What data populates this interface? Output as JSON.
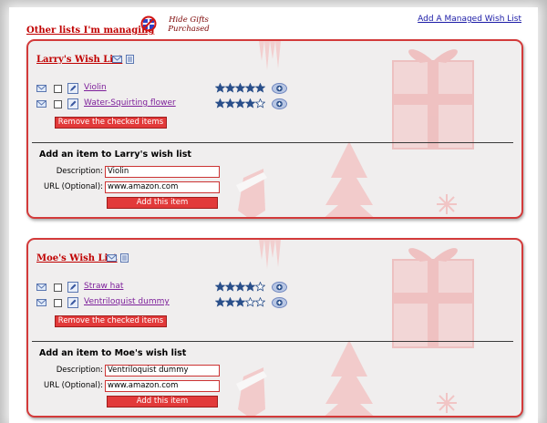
{
  "header": {
    "other_lists_label": "Other lists I'm managing",
    "hide_gifts_line1": "Hide Gifts",
    "hide_gifts_line2": "Purchased",
    "add_managed_link": "Add A Managed Wish List"
  },
  "lists": [
    {
      "title": "Larry's Wish List",
      "items": [
        {
          "name": "Violin",
          "rating": 5,
          "max_rating": 5
        },
        {
          "name": "Water-Squirting flower",
          "rating": 4,
          "max_rating": 5
        }
      ],
      "remove_button": "Remove the checked items",
      "add_heading": "Add an item to Larry's wish list",
      "description_label": "Description:",
      "description_value": "Violin",
      "url_label": "URL (Optional):",
      "url_value": "www.amazon.com",
      "add_button": "Add this item"
    },
    {
      "title": "Moe's Wish List",
      "items": [
        {
          "name": "Straw hat",
          "rating": 4,
          "max_rating": 5
        },
        {
          "name": "Ventriloquist dummy",
          "rating": 3,
          "max_rating": 5
        }
      ],
      "remove_button": "Remove the checked items",
      "add_heading": "Add an item to Moe's wish list",
      "description_label": "Description:",
      "description_value": "Ventriloquist dummy",
      "url_label": "URL (Optional):",
      "url_value": "www.amazon.com",
      "add_button": "Add this item"
    }
  ],
  "icons": {
    "mail": "mail-icon",
    "notes": "notes-icon",
    "edit": "edit-pencil-icon",
    "star": "star-icon",
    "plus": "plus-icon",
    "hide_gifts": "hide-gifts-icon"
  },
  "colors": {
    "accent_red": "#c00000",
    "panel_border": "#d33a3a",
    "button_red": "#e23a3a",
    "link_purple": "#7d1f9a",
    "link_blue": "#1a1aa6",
    "star_blue": "#2a4f8a"
  }
}
